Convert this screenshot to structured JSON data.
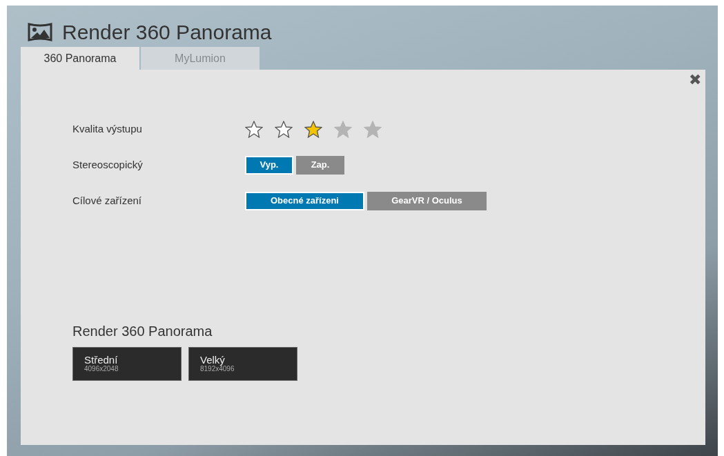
{
  "window": {
    "title": "Render 360 Panorama"
  },
  "tabs": [
    {
      "label": "360 Panorama",
      "selected": true
    },
    {
      "label": "MyLumion",
      "selected": false
    }
  ],
  "close": {
    "label": "✖"
  },
  "settings": [
    {
      "label": "Kvalita výstupu",
      "kind": "rating",
      "options": [
        {
          "selected": false,
          "disabled": false
        },
        {
          "selected": false,
          "disabled": false
        },
        {
          "selected": true,
          "disabled": false
        },
        {
          "selected": false,
          "disabled": true
        },
        {
          "selected": false,
          "disabled": true
        }
      ]
    },
    {
      "label": "Stereoscopický",
      "kind": "toggle",
      "options": [
        {
          "label": "Vyp.",
          "selected": true
        },
        {
          "label": "Zap.",
          "selected": false
        }
      ]
    },
    {
      "label": "Cílové zařízení",
      "kind": "toggle",
      "wide": true,
      "options": [
        {
          "label": "Obecné zařízeni",
          "selected": true
        },
        {
          "label": "GearVR / Oculus",
          "selected": false
        }
      ]
    }
  ],
  "render": {
    "title": "Render 360 Panorama",
    "buttons": [
      {
        "label": "Střední",
        "size": "4096x2048"
      },
      {
        "label": "Velký",
        "size": "8192x4096"
      }
    ]
  }
}
